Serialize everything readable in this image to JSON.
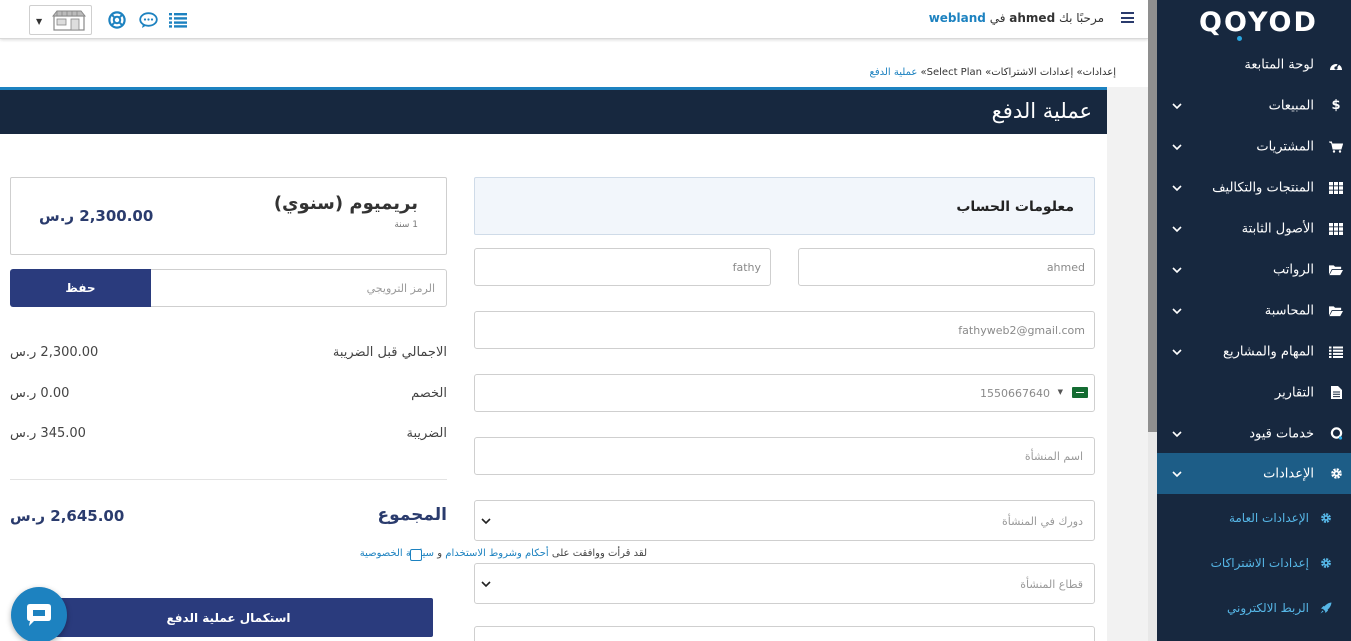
{
  "brand": {
    "logo_text": "QOYOD",
    "accent": "#1d82c0",
    "sidebar_bg": "#17283f",
    "primary_button": "#2a3b7d"
  },
  "topbar": {
    "welcome_prefix": "مرحبًا بك",
    "user": "ahmed",
    "in_word": "في",
    "org": "webland",
    "icons": [
      "menu-icon",
      "list-icon",
      "chat-icon",
      "support-icon",
      "store-icon"
    ]
  },
  "sidebar": {
    "items": [
      {
        "label": "لوحة المتابعة",
        "icon": "dashboard-icon",
        "expandable": false
      },
      {
        "label": "المبيعات",
        "icon": "dollar-icon",
        "expandable": true
      },
      {
        "label": "المشتريات",
        "icon": "cart-icon",
        "expandable": true
      },
      {
        "label": "المنتجات والتكاليف",
        "icon": "grid-icon",
        "expandable": true
      },
      {
        "label": "الأصول الثابتة",
        "icon": "grid-icon",
        "expandable": true
      },
      {
        "label": "الرواتب",
        "icon": "folder-icon",
        "expandable": true
      },
      {
        "label": "المحاسبة",
        "icon": "folder-icon",
        "expandable": true
      },
      {
        "label": "المهام والمشاريع",
        "icon": "list-icon",
        "expandable": true
      },
      {
        "label": "التقارير",
        "icon": "file-icon",
        "expandable": false
      },
      {
        "label": "خدمات قيود",
        "icon": "qoyod-icon",
        "expandable": true
      },
      {
        "label": "الإعدادات",
        "icon": "gear-icon",
        "expandable": true,
        "active": true
      }
    ],
    "subitems": [
      {
        "label": "الإعدادات العامة",
        "icon": "gear-icon"
      },
      {
        "label": "إعدادات الاشتراكات",
        "icon": "gear-icon"
      },
      {
        "label": "الربط الالكتروني",
        "icon": "rocket-icon"
      }
    ]
  },
  "breadcrumb": {
    "items": [
      "إعدادات",
      "إعدادات الاشتراكات",
      "Select Plan"
    ],
    "separator": "»",
    "current": "عملية الدفع"
  },
  "page": {
    "title": "عملية الدفع"
  },
  "account": {
    "header": "معلومات الحساب",
    "first_name": "ahmed",
    "last_name": "fathy",
    "email": "fathyweb2@gmail.com",
    "phone": "1550667640",
    "company_placeholder": "اسم المنشأة",
    "role_placeholder": "دورك في المنشأة",
    "sector_placeholder": "قطاع المنشأة"
  },
  "plan": {
    "name": "بريميوم (سنوي)",
    "period": "1 سنة",
    "price": "2,300.00 ر.س"
  },
  "promo": {
    "placeholder": "الرمز الترويجي",
    "button": "حفظ"
  },
  "summary": {
    "rows": [
      {
        "label": "الاجمالي قبل الضريبة",
        "value": "2,300.00 ر.س"
      },
      {
        "label": "الخصم",
        "value": "0.00 ر.س"
      },
      {
        "label": "الضريبة",
        "value": "345.00 ر.س"
      }
    ],
    "total_label": "المجموع",
    "total_value": "2,645.00 ر.س"
  },
  "terms": {
    "prefix": "لقد قرأت ووافقت على",
    "link1": "أحكام وشروط الاستخدام",
    "and": "و",
    "link2": "سياسة الخصوصية",
    "checked": false
  },
  "checkout": {
    "button": "استكمال عملية الدفع"
  }
}
